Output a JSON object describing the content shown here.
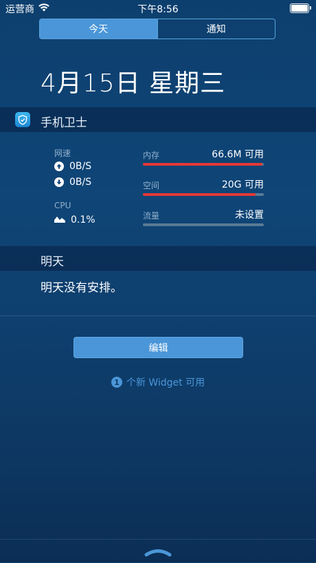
{
  "status_bar": {
    "carrier": "运营商",
    "time": "下午8:56"
  },
  "tabs": [
    {
      "label": "今天",
      "active": true
    },
    {
      "label": "通知",
      "active": false
    }
  ],
  "date_title": "4月15日 星期三",
  "widget_security": {
    "title": "手机卫士",
    "network_label": "网速",
    "upload": "0B/S",
    "download": "0B/S",
    "cpu_label": "CPU",
    "cpu_value": "0.1%",
    "memory": {
      "label": "内存",
      "value": "66.6M 可用",
      "used_fraction": 0.99
    },
    "storage": {
      "label": "空间",
      "value": "20G 可用",
      "used_fraction": 0.93
    },
    "traffic": {
      "label": "流量",
      "value": "未设置",
      "used_fraction": 0.0
    }
  },
  "tomorrow": {
    "title": "明天",
    "text": "明天没有安排。"
  },
  "edit_button": "编辑",
  "new_widget": {
    "count": "1",
    "text": "个新 Widget 可用"
  },
  "colors": {
    "accent": "#4a96d8",
    "bar_fill": "#e53935",
    "bar_track": "#5a7a96"
  }
}
